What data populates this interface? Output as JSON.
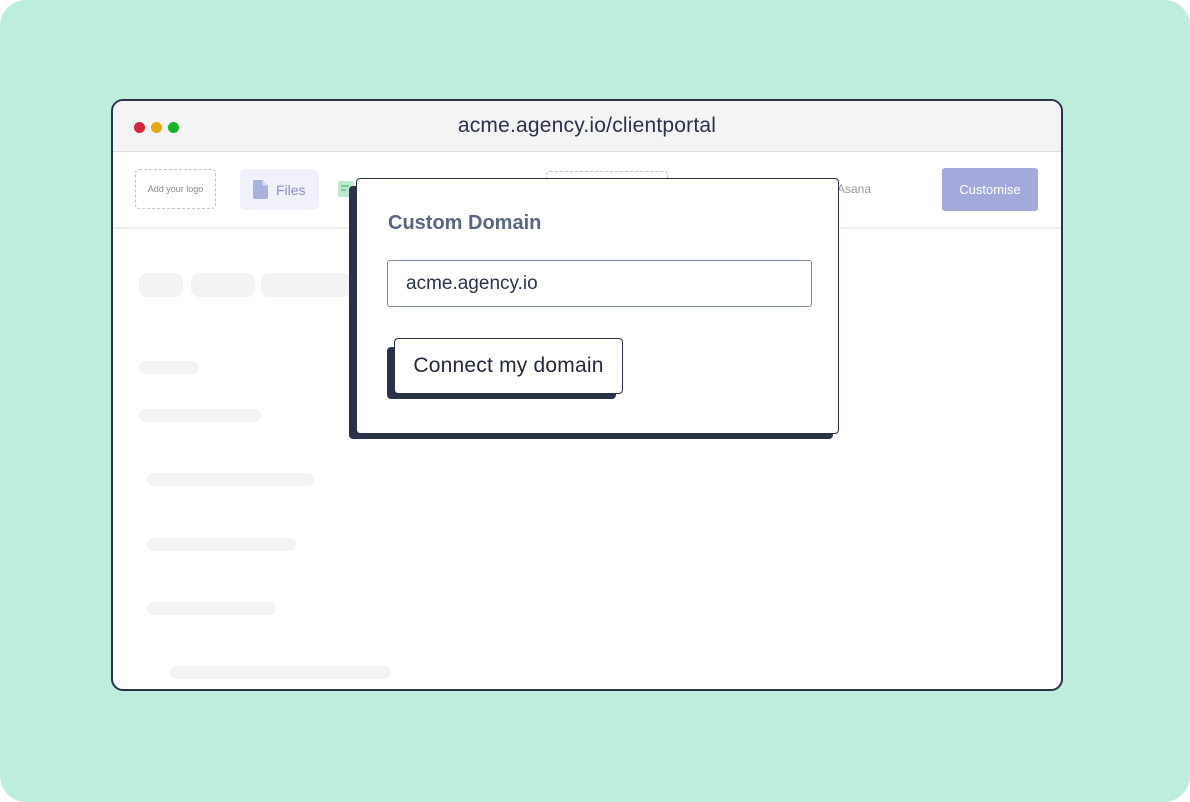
{
  "browser": {
    "url": "acme.agency.io/clientportal"
  },
  "appbar": {
    "logo_placeholder": "Add your logo",
    "tabs": [
      {
        "label": "Files",
        "icon": "file-icon"
      },
      {
        "label": "Asana"
      }
    ],
    "customise_label": "Customise"
  },
  "modal": {
    "title": "Custom Domain",
    "domain_value": "acme.agency.io",
    "connect_label": "Connect my domain"
  },
  "colors": {
    "backdrop": "#bdeedc",
    "navy": "#2a3149",
    "customise_button": "#a3aadb",
    "files_tab_bg": "#f0f1fb"
  }
}
